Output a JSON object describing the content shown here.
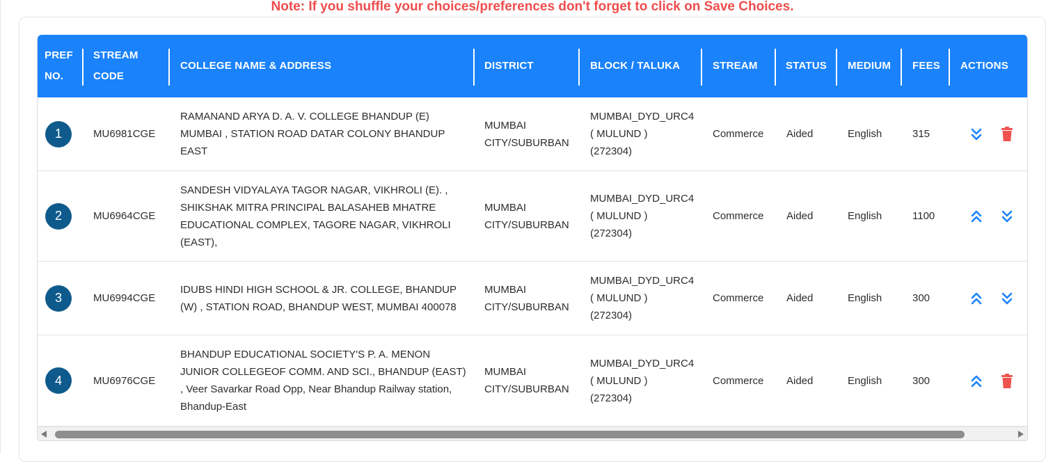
{
  "note": "Note: If you shuffle your choices/preferences don't forget to click on Save Choices.",
  "colors": {
    "header_bg": "#1a82fb",
    "note_red": "#ef4d4d",
    "pref_circle": "#0f5a8c",
    "action_blue": "#1a82fb",
    "delete_red": "#f0524f"
  },
  "table": {
    "headers": {
      "pref_no": [
        "PREF",
        "NO."
      ],
      "stream_code": [
        "STREAM",
        "CODE"
      ],
      "college": "COLLEGE NAME & ADDRESS",
      "district": "DISTRICT",
      "block": "BLOCK / TALUKA",
      "stream": "STREAM",
      "status": "STATUS",
      "medium": "MEDIUM",
      "fees": "FEES",
      "actions": "ACTIONS"
    },
    "rows": [
      {
        "pref": "1",
        "code": "MU6981CGE",
        "college": [
          "RAMANAND ARYA D. A. V. COLLEGE BHANDUP (E)",
          "MUMBAI , STATION ROAD DATAR COLONY BHANDUP",
          "EAST"
        ],
        "district": [
          "MUMBAI",
          "CITY/SUBURBAN"
        ],
        "block": [
          "MUMBAI_DYD_URC4",
          "( MULUND )",
          "(272304)"
        ],
        "stream": "Commerce",
        "status": "Aided",
        "medium": "English",
        "fees": "315",
        "actions": [
          "move-down",
          "delete"
        ]
      },
      {
        "pref": "2",
        "code": "MU6964CGE",
        "college": [
          "SANDESH VIDYALAYA TAGOR NAGAR, VIKHROLI (E). ,",
          "SHIKSHAK MITRA PRINCIPAL BALASAHEB MHATRE",
          "EDUCATIONAL COMPLEX, TAGORE NAGAR, VIKHROLI",
          "(EAST),"
        ],
        "district": [
          "MUMBAI",
          "CITY/SUBURBAN"
        ],
        "block": [
          "MUMBAI_DYD_URC4",
          "( MULUND )",
          "(272304)"
        ],
        "stream": "Commerce",
        "status": "Aided",
        "medium": "English",
        "fees": "1100",
        "actions": [
          "move-up",
          "move-down"
        ]
      },
      {
        "pref": "3",
        "code": "MU6994CGE",
        "college": [
          "IDUBS HINDI HIGH SCHOOL & JR. COLLEGE, BHANDUP",
          "(W) , STATION ROAD, BHANDUP WEST, MUMBAI 400078"
        ],
        "district": [
          "MUMBAI",
          "CITY/SUBURBAN"
        ],
        "block": [
          "MUMBAI_DYD_URC4",
          "( MULUND )",
          "(272304)"
        ],
        "stream": "Commerce",
        "status": "Aided",
        "medium": "English",
        "fees": "300",
        "actions": [
          "move-up",
          "move-down"
        ]
      },
      {
        "pref": "4",
        "code": "MU6976CGE",
        "college": [
          "BHANDUP EDUCATIONAL SOCIETY'S P. A. MENON",
          "JUNIOR COLLEGEOF COMM. AND SCI., BHANDUP (EAST)",
          ", Veer Savarkar Road Opp, Near Bhandup Railway station,",
          "Bhandup-East"
        ],
        "district": [
          "MUMBAI",
          "CITY/SUBURBAN"
        ],
        "block": [
          "MUMBAI_DYD_URC4",
          "( MULUND )",
          "(272304)"
        ],
        "stream": "Commerce",
        "status": "Aided",
        "medium": "English",
        "fees": "300",
        "actions": [
          "move-up",
          "delete"
        ]
      }
    ]
  }
}
